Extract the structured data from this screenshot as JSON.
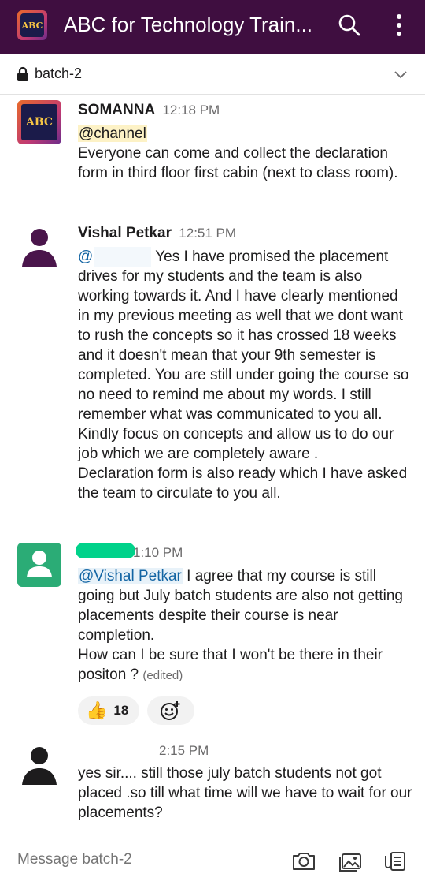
{
  "appbar": {
    "title": "ABC for Technology Train...",
    "workspace_logo_text": "ABC",
    "color": "#3f0e40"
  },
  "channel": {
    "name": "batch-2"
  },
  "messages": [
    {
      "sender": "SOMANNA",
      "time": "12:18 PM",
      "mention": "@channel",
      "text": "Everyone can come and collect the declaration form in third floor first cabin (next to class room)."
    },
    {
      "sender": "Vishal Petkar",
      "time": "12:51 PM",
      "mention": "@",
      "text": "Yes I have promised the placement drives for my students and the team is also working towards it. And I have clearly mentioned in my previous meeting as well that we dont want to rush the concepts so it has crossed 18 weeks and it doesn't mean that your 9th semester is completed. You are still under going the course so no need to remind me about my words. I still remember what was communicated to you all. Kindly focus on concepts and allow us to do our job which we are completely aware .",
      "text2": "Declaration form is also ready which I have asked the team to circulate to you all."
    },
    {
      "sender": "",
      "time": "1:10 PM",
      "mention": "@Vishal Petkar",
      "text": "I agree that my course is still going but July batch students are also not getting placements despite their course is near completion.",
      "text2": "How can I be sure that I won't be there in their positon ?",
      "edited": "(edited)",
      "reaction_emoji": "👍",
      "reaction_count": "18"
    },
    {
      "sender": "",
      "time": "2:15 PM",
      "text": "yes sir.... still those july batch students not got placed .so till what time  will we have to wait for our placements?"
    }
  ],
  "composer": {
    "placeholder": "Message batch-2"
  },
  "colors": {
    "mention_highlight": "#fdf2c6",
    "link_blue": "#1264a3",
    "green_avatar": "#2bac76"
  }
}
